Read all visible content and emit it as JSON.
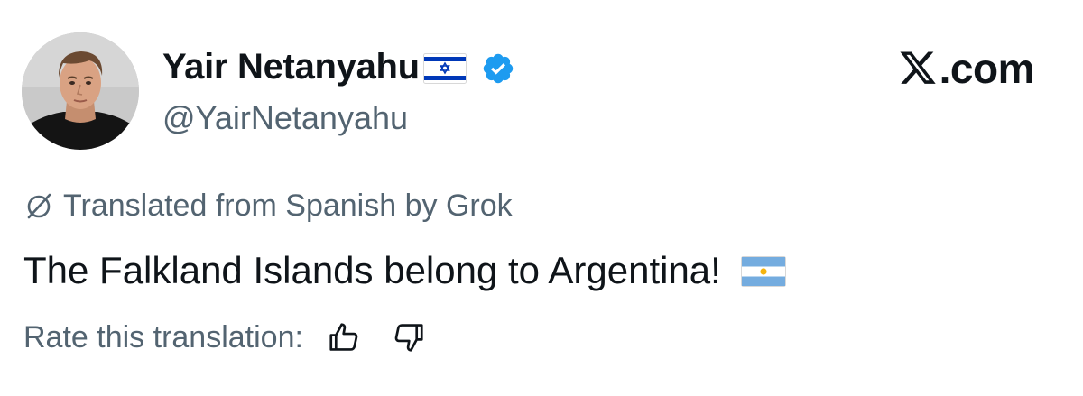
{
  "author": {
    "display_name": "Yair Netanyahu",
    "handle": "@YairNetanyahu",
    "name_flag": "israel-flag-emoji",
    "verified_badge": "verified-badge-icon",
    "avatar": "profile-photo"
  },
  "brand": {
    "label": ".com",
    "logo": "x-logo-icon"
  },
  "translation": {
    "notice": "Translated from Spanish by Grok",
    "icon": "translate-icon"
  },
  "post": {
    "text": "The Falkland Islands belong to Argentina!",
    "trailing_emoji": "argentina-flag-emoji"
  },
  "rating": {
    "prompt": "Rate this translation:",
    "up_icon": "thumbs-up-icon",
    "down_icon": "thumbs-down-icon"
  },
  "colors": {
    "text_primary": "#0f1419",
    "text_secondary": "#536471",
    "verified_blue": "#1d9bf0",
    "israel_blue": "#0038b8",
    "argentina_blue": "#74acdf",
    "argentina_sun": "#f6b40e",
    "background": "#ffffff"
  }
}
